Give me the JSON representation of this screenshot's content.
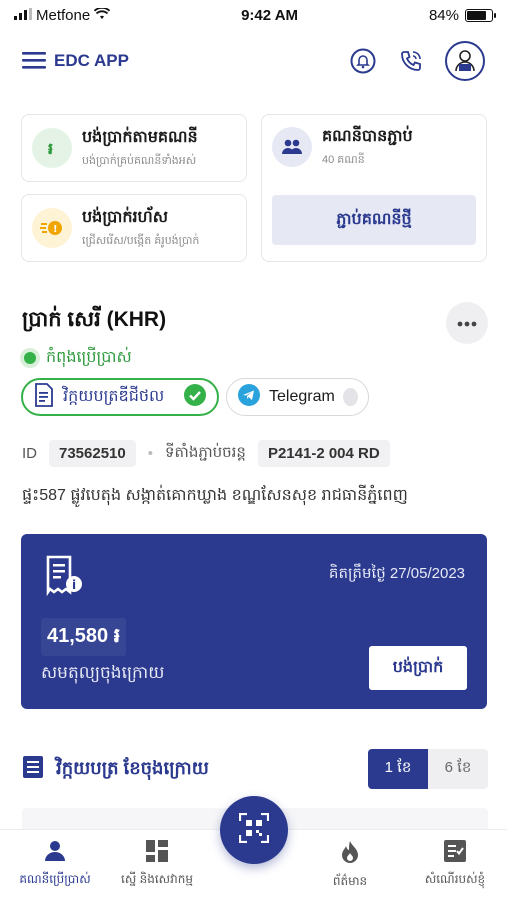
{
  "status_bar": {
    "carrier": "Metfone",
    "time": "9:42 AM",
    "battery": "84%",
    "battery_level": 0.84
  },
  "header": {
    "title": "EDC APP"
  },
  "quick_cards": {
    "pay_by_account": {
      "title": "បង់ប្រាក់តាមគណនី",
      "subtitle": "បង់ប្រាក់គ្រប់គណនីទាំងអស់"
    },
    "linked_accounts": {
      "title": "គណនីបានភ្ជាប់",
      "subtitle": "40 គណនី",
      "button": "ភ្ជាប់គណនីថ្មី"
    },
    "quick_pay": {
      "title": "បង់ប្រាក់រហ័ស",
      "subtitle": "ជ្រើសរើស/បង្កើត គំរូបង់ប្រាក់"
    }
  },
  "account": {
    "name": "ប្រាក់ សេរី  (KHR)",
    "status": "កំពុងប្រើប្រាស់",
    "einvoice_label": "វិក្កយបត្រឌីជីថល",
    "telegram_label": "Telegram",
    "id_label": "ID",
    "id_value": "73562510",
    "location_label": "ទីតាំងភ្ជាប់ចរន្ត",
    "location_value": "P2141-2 004 RD",
    "address": "ផ្ទះ587 ផ្លូវបេតុង  សង្កាត់គោកឃ្លាង ខណ្ឌសែនសុខ រាជធានីភ្នំពេញ"
  },
  "balance": {
    "due_label": "គិតត្រឹមថ្ងៃ 27/05/2023",
    "amount": "41,580 ៛",
    "label": "សមតុល្យចុងក្រោយ",
    "pay_button": "បង់ប្រាក់"
  },
  "invoices": {
    "title": "វិក្កយបត្រ ខែចុងក្រោយ",
    "segments": [
      "1 ខែ",
      "6 ខែ"
    ],
    "active_segment": 0
  },
  "bottom_nav": {
    "items": [
      {
        "label": "គណនីប្រើប្រាស់",
        "icon": "person-icon",
        "active": true
      },
      {
        "label": "ស្នើ និងសេវាកម្ម",
        "icon": "grid-icon",
        "active": false
      },
      {
        "label": "ព័ត៌មាន",
        "icon": "flame-icon",
        "active": false
      },
      {
        "label": "សំណើរបស់ខ្ញុំ",
        "icon": "checklist-icon",
        "active": false
      }
    ],
    "fab_icon": "qr-scan-icon"
  },
  "colors": {
    "primary": "#2b3a8f",
    "success": "#35b14a",
    "muted_bg": "#efeff2"
  }
}
